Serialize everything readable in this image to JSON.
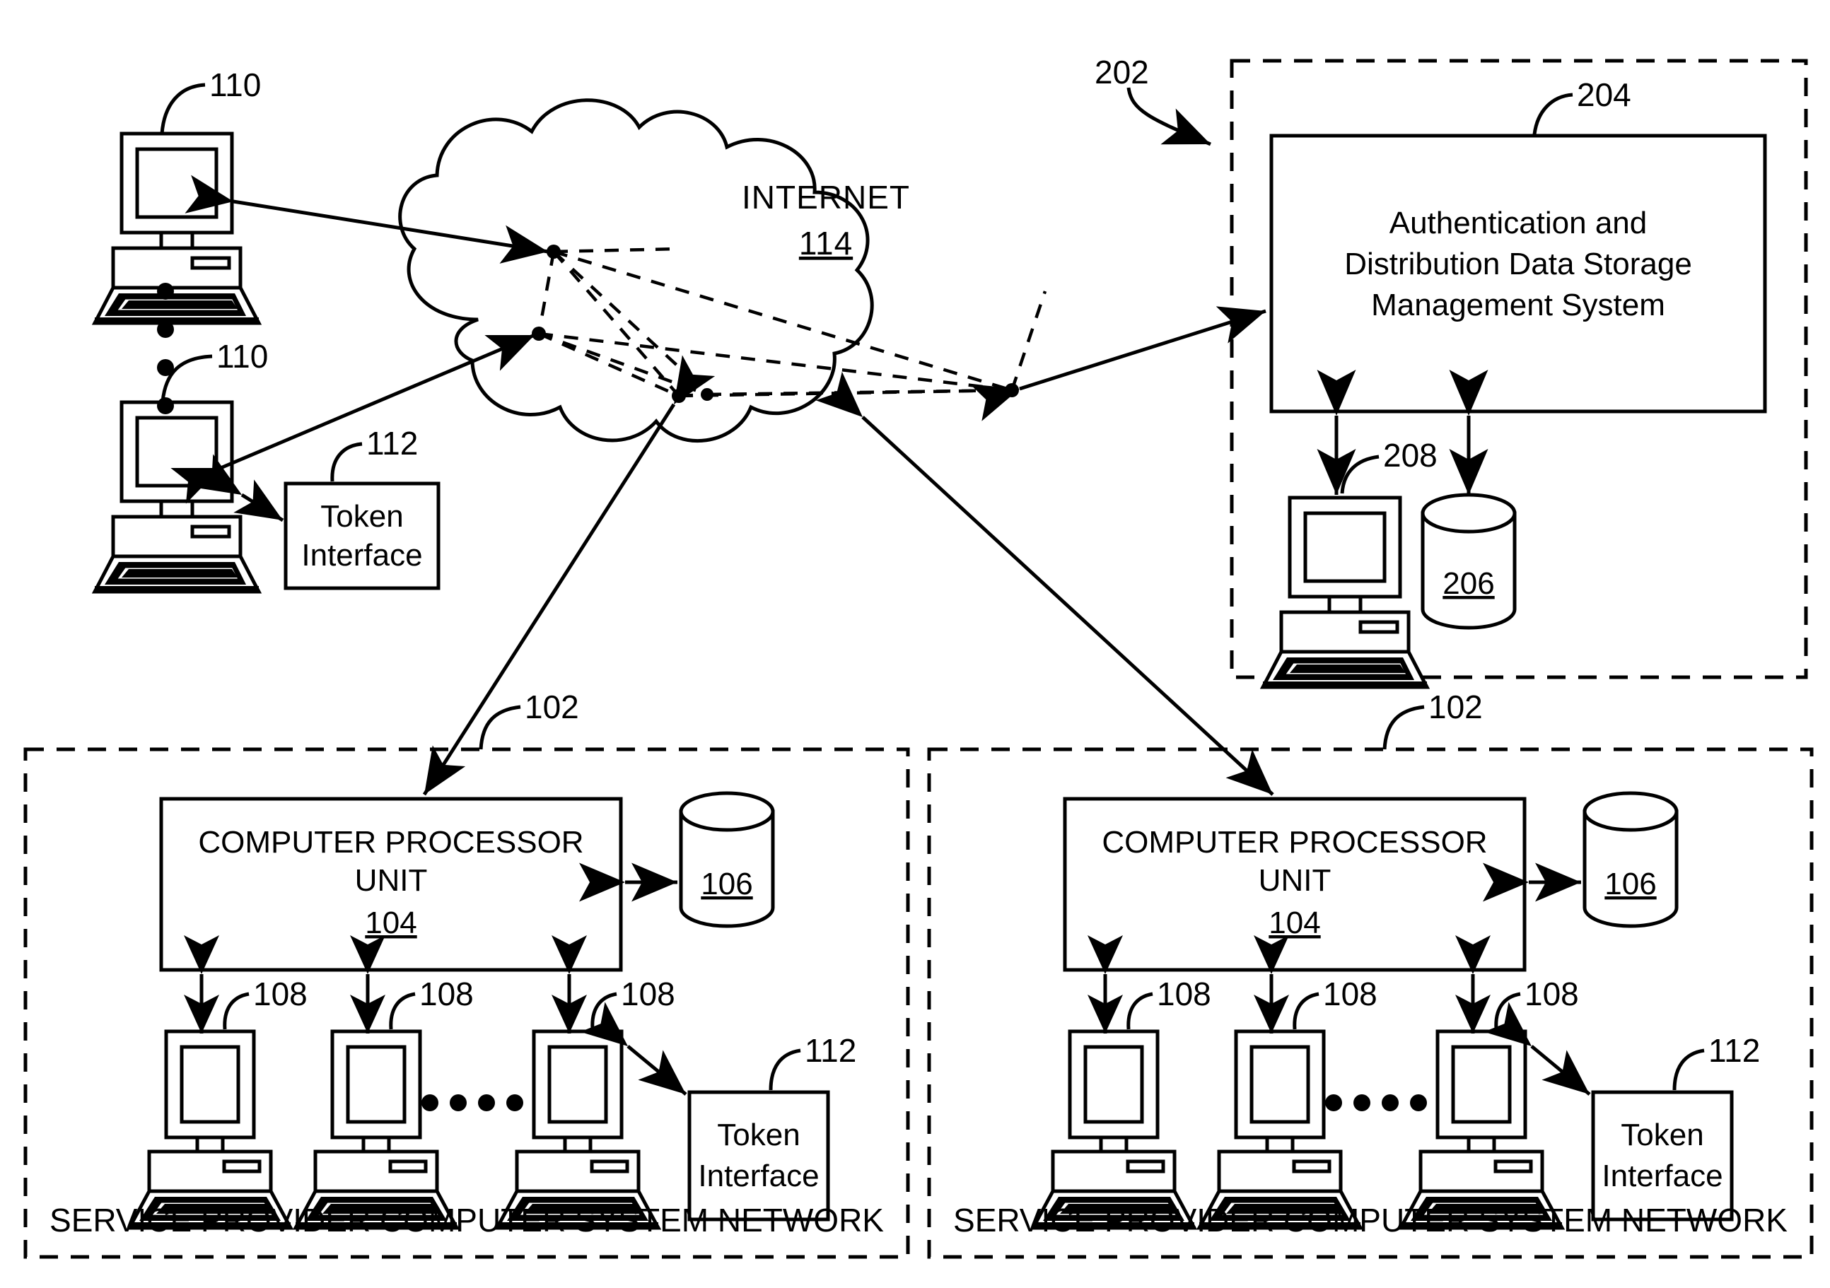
{
  "figure": {
    "type": "patent-network-diagram",
    "background_color": "#ffffff",
    "line_color": "#000000"
  },
  "internet_cloud": {
    "label": "INTERNET",
    "ref": "114",
    "ref_underlined": true,
    "node_count": 4
  },
  "client_terminals": [
    {
      "ref": "110",
      "name": "client-computer-top"
    },
    {
      "ref": "110",
      "name": "client-computer-bottom"
    }
  ],
  "client_vertical_ellipsis_dots": 4,
  "client_token_interface": {
    "line1": "Token",
    "line2": "Interface",
    "ref": "112"
  },
  "management_enclosure": {
    "ref": "202",
    "style": "dashed",
    "system_box": {
      "ref": "204",
      "line1": "Authentication and",
      "line2": "Distribution Data Storage",
      "line3": "Management System"
    },
    "admin_computer": {
      "ref": "208"
    },
    "database": {
      "ref": "206",
      "ref_underlined": true
    }
  },
  "service_provider_networks": [
    {
      "ref": "102",
      "caption": "SERVICE PROVIDER COMPUTER SYSTEM NETWORK",
      "processor_box": {
        "line1": "COMPUTER PROCESSOR",
        "line2": "UNIT",
        "ref": "104",
        "ref_underlined": true
      },
      "database": {
        "ref": "106",
        "ref_underlined": true
      },
      "terminal_refs": [
        "108",
        "108",
        "108"
      ],
      "terminal_count": 3,
      "ellipsis_dots": 4,
      "token_interface": {
        "line1": "Token",
        "line2": "Interface",
        "ref": "112"
      }
    },
    {
      "ref": "102",
      "caption": "SERVICE PROVIDER COMPUTER SYSTEM NETWORK",
      "processor_box": {
        "line1": "COMPUTER PROCESSOR",
        "line2": "UNIT",
        "ref": "104",
        "ref_underlined": true
      },
      "database": {
        "ref": "106",
        "ref_underlined": true
      },
      "terminal_refs": [
        "108",
        "108",
        "108"
      ],
      "terminal_count": 3,
      "ellipsis_dots": 4,
      "token_interface": {
        "line1": "Token",
        "line2": "Interface",
        "ref": "112"
      }
    }
  ]
}
